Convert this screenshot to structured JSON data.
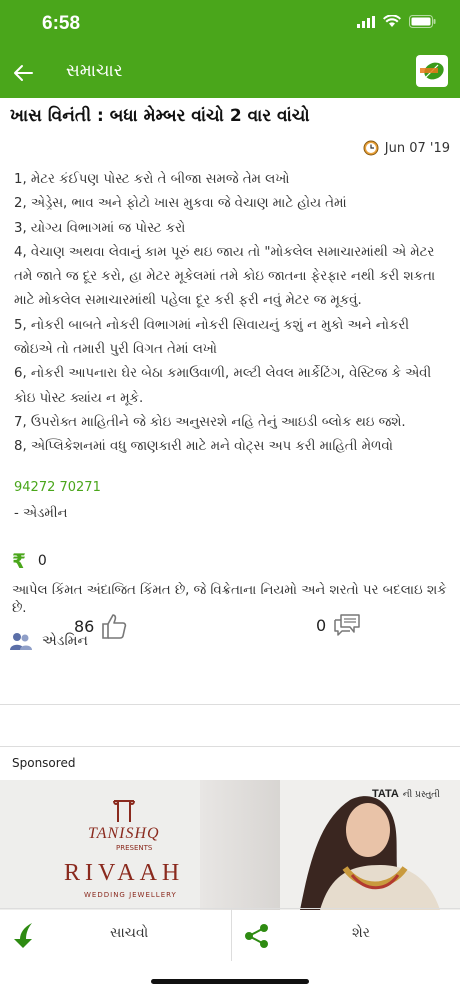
{
  "status": {
    "time": "6:58"
  },
  "appbar": {
    "title": "સમાચાર"
  },
  "article": {
    "headline": "ખાસ વિનંતી : બધા મેમ્બર વાંચો 2 વાર વાંચો",
    "date": "Jun 07 '19",
    "lines": [
      "1, મેટર કંઈપણ પોસ્ટ કરો તે બીજા સમજે તેમ લખો",
      "2, એડ્રેસ, ભાવ અને ફોટો ખાસ મુકવા જે વેચાણ માટે હોય તેમાં",
      "3, યોગ્ય વિભાગમાં જ પોસ્ટ કરો",
      "4, વેચાણ અથવા લેવાનું કામ પૂરું થઇ જાય તો \"મોકલેલ સમાચારમાંથી એ મેટર તમે જાતે જ દૂર કરો, હા મેટર મૂકેલમાં તમે કોઇ જાતના ફેરફાર નથી કરી શકતા માટે મોકલેલ સમાચારમાંથી પહેલા દૂર કરી ફરી નવું મેટર જ મૂકવું.",
      "5, નોકરી બાબતે નોકરી વિભાગમાં નોકરી સિવાયનું કશું ન મુકો અને નોકરી જોઇએ તો તમારી પુરી વિગત તેમાં લખો",
      "6, નોકરી આપનારા ઘેર બેઠા કમાઉવાળી, મલ્ટી લેવલ માર્કેટિંગ, વેસ્ટિજ કે એવી કોઇ પોસ્ટ ક્યાંય ન મૂકે.",
      "7, ઉપરોક્ત માહિતીને જે કોઇ અનુસરશે નહિ તેનું આઇડી બ્લોક થઇ જશે.",
      "8, એપ્લિકેશનમાં વધુ જાણકારી માટે મને વોટ્સ અપ કરી માહિતી મેળવો"
    ],
    "phone": "94272 70271",
    "signature": "- એડમીન",
    "price": "0",
    "price_symbol": "₹",
    "disclaimer": "આપેલ કિંમત અંદાજિત કિંમત છે, જે વિક્રેતાના નિયમો અને શરતો પર બદલાઇ શકે છે.",
    "author": "એડમિન"
  },
  "engagement": {
    "likes": "86",
    "comments": "0"
  },
  "ad": {
    "label": "Sponsored",
    "brand": "TANISHQ",
    "presents": "PRESENTS",
    "collection": "RIVAAH",
    "tagline": "WEDDING JEWELLERY",
    "tata": "TATA",
    "tata_sub": "ની પ્રસ્તુતી"
  },
  "bottom": {
    "save_label": "સાચવો",
    "share_label": "શેર"
  },
  "colors": {
    "accent": "#4aa61b"
  }
}
